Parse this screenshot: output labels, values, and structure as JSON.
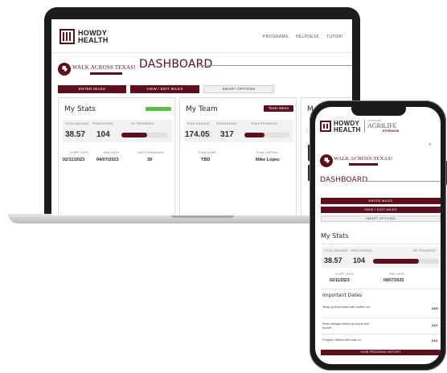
{
  "laptop": {
    "brand_line1": "HOWDY",
    "brand_line2": "HEALTH",
    "nav": [
      "PROGRAMS",
      "HELPDESK",
      "TUTORI"
    ],
    "wat_title": "WALK ACROSS TEXAS!",
    "page_title": "DASHBOARD",
    "buttons": {
      "enter_miles": "ENTER MILES",
      "view_edit_miles": "VIEW / EDIT MILES",
      "smart_options": "SMART OPTIONS"
    },
    "my_stats": {
      "title": "My Stats",
      "col_labels": [
        "TOTAL MILEAGE",
        "PERCENTAGE",
        "MY PROGRESS"
      ],
      "miles": "38.57",
      "percent": "104",
      "progress": 0.55,
      "sub_labels": [
        "START DATE",
        "END DATE",
        "DAYS REMAINING"
      ],
      "start_date": "02/11/2023",
      "end_date": "04/07/2023",
      "days": "39"
    },
    "my_team": {
      "title": "My Team",
      "team_menu": "Team Menu",
      "col_labels": [
        "TEAM MILEAGE",
        "PERCENTAGE",
        "TEAM PROGRESS"
      ],
      "miles": "174.05",
      "percent": "317",
      "progress": 0.45,
      "sub_labels": [
        "TEAM NAME",
        "TEAM CAPTAIN"
      ],
      "team_name": "TBD",
      "captain": "Mike Lopez"
    },
    "third_card_title": "M"
  },
  "phone": {
    "brand_line1": "HOWDY",
    "brand_line2": "HEALTH",
    "agrilife_top": "TEXAS A&M",
    "agrilife_word": "AGRILIFE",
    "agrilife_ext": "EXTENSION",
    "wat_title": "WALK ACROSS TEXAS!",
    "page_title": "DASHBOARD",
    "buttons": {
      "enter_miles": "ENTER MILES",
      "view_edit_miles": "VIEW / EDIT MILES",
      "smart_options": "SMART OPTIONS"
    },
    "my_stats": {
      "title": "My Stats",
      "col_labels": [
        "TOTAL MILEAGE",
        "PERCENTAGE",
        "MY PROGRESS"
      ],
      "miles": "38.57",
      "percent": "104",
      "progress": 0.7,
      "sub_labels": [
        "START DATE",
        "END DATE"
      ],
      "start_date": "02/11/2023",
      "end_date": "04/07/2023"
    },
    "important_dates": {
      "title": "Important Dates",
      "items": [
        {
          "label": "Wrap up final walks with mobile run",
          "date": "04/0"
        },
        {
          "label": "Final mileage entries as home and bucket",
          "date": "04/1"
        },
        {
          "label": "Program Status with lead on",
          "date": "04/1"
        }
      ]
    },
    "view_program_history": "VIEW PROGRAM HISTORY"
  },
  "colors": {
    "maroon": "#5e0f1c",
    "green": "#58c04a",
    "laptop_body": "#1d1d1f"
  }
}
